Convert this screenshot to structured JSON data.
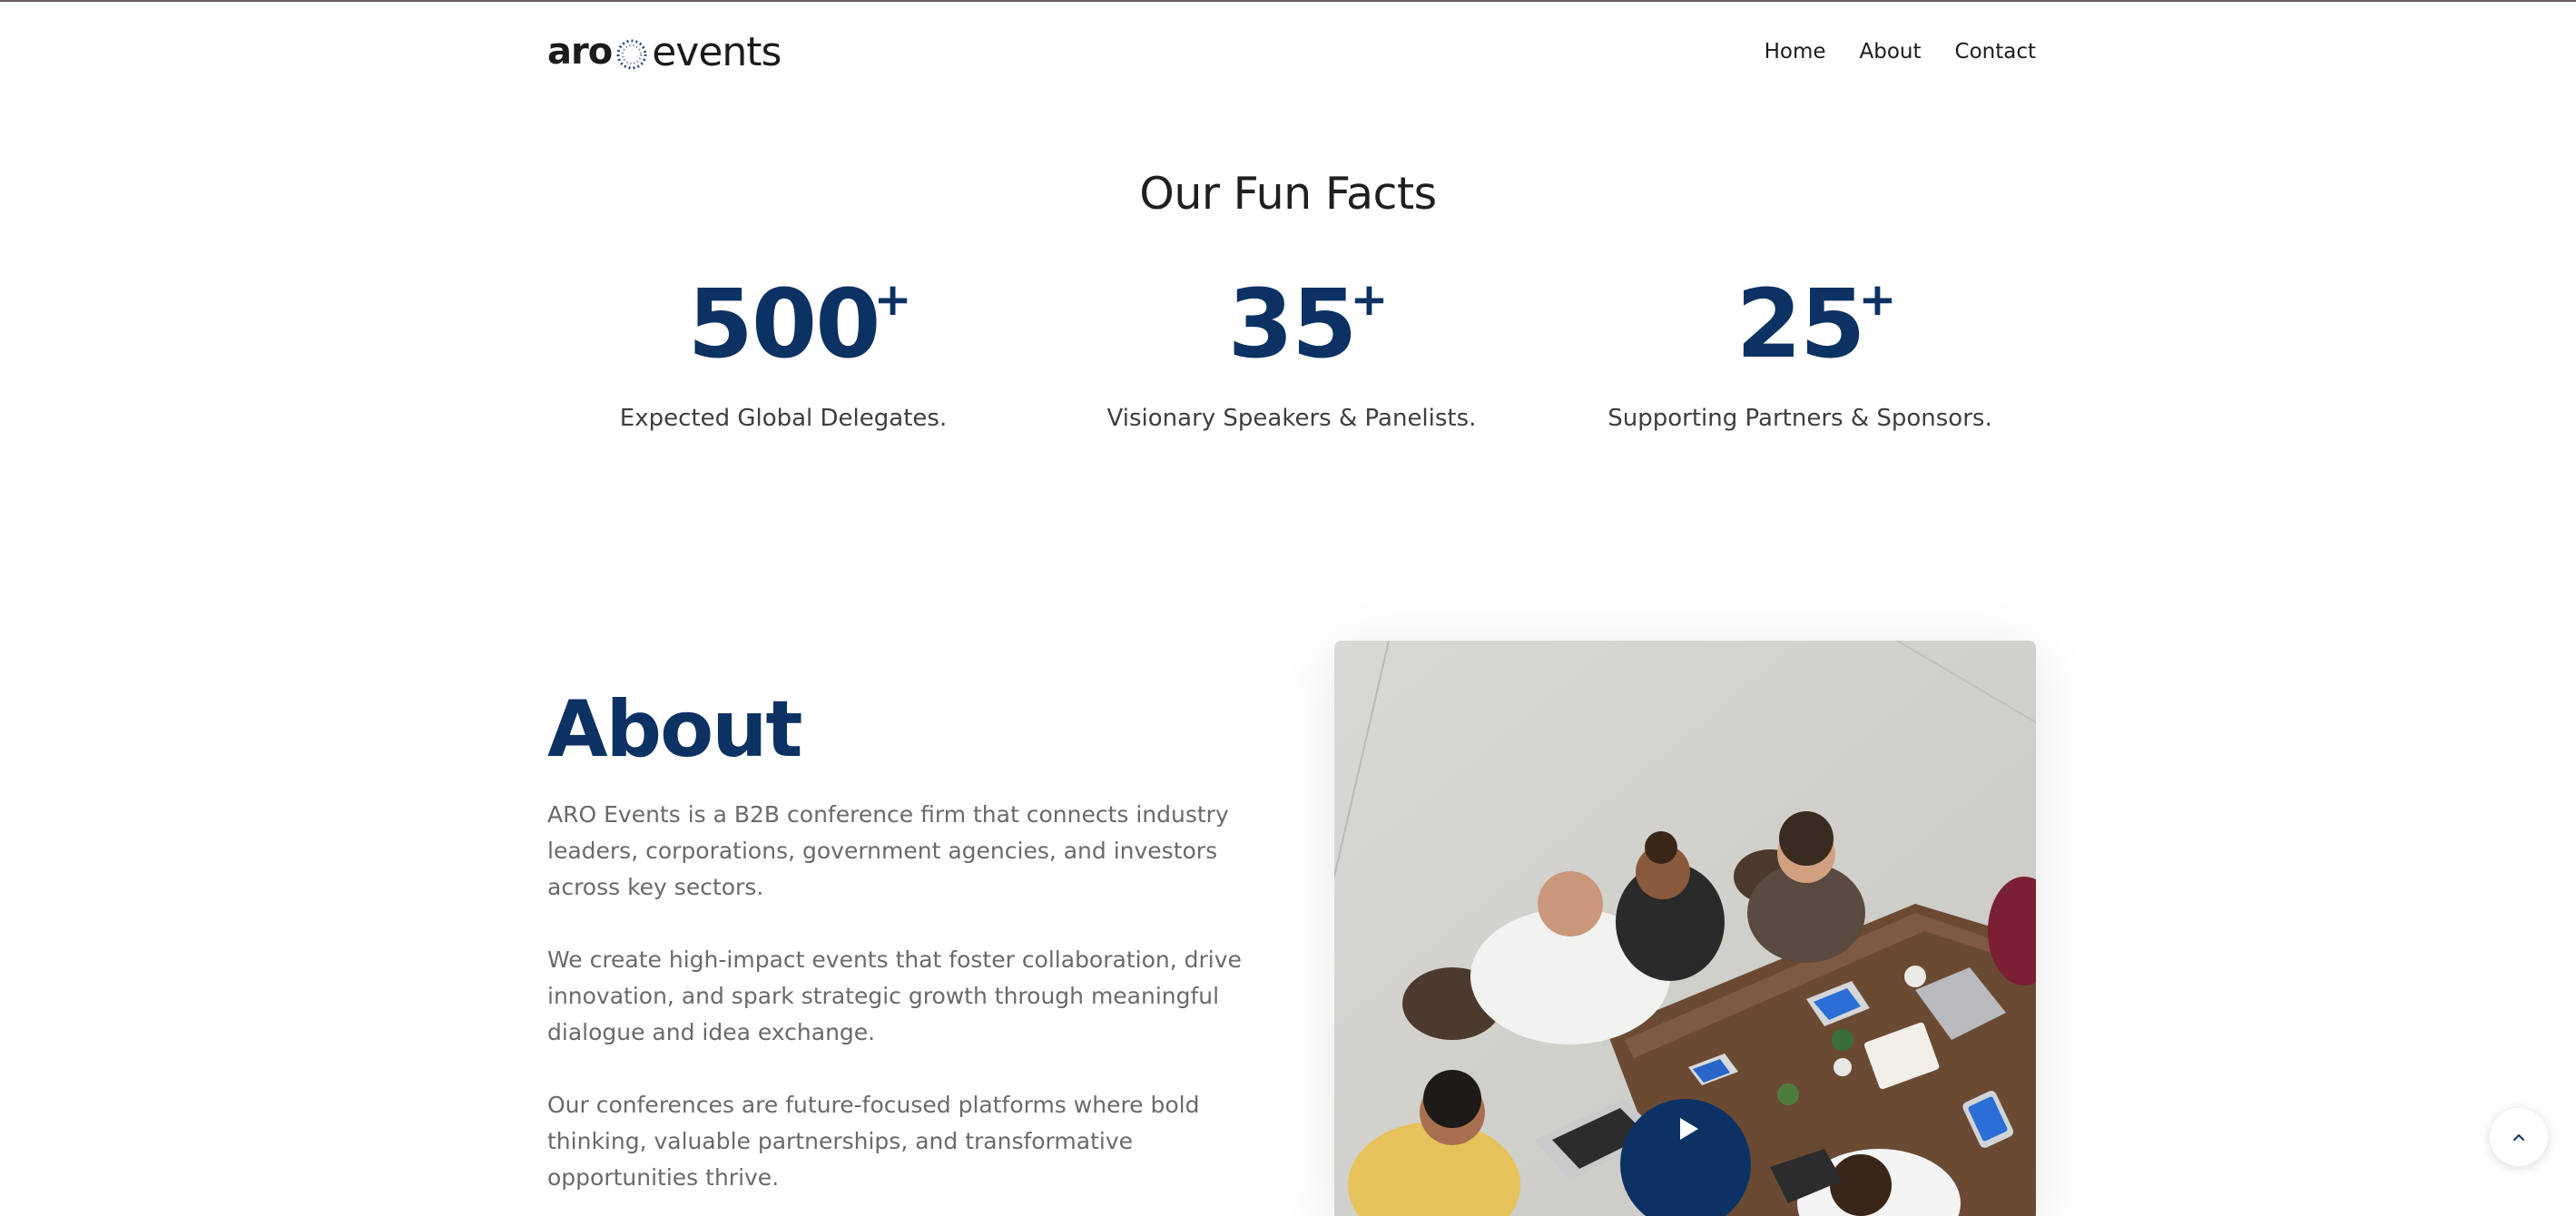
{
  "brand": {
    "logo_left": "aro",
    "logo_right": "events"
  },
  "nav": {
    "items": [
      {
        "label": "Home"
      },
      {
        "label": "About"
      },
      {
        "label": "Contact"
      }
    ]
  },
  "facts": {
    "title": "Our Fun Facts",
    "items": [
      {
        "number": "500",
        "suffix": "+",
        "label": "Expected Global Delegates."
      },
      {
        "number": "35",
        "suffix": "+",
        "label": "Visionary Speakers & Panelists."
      },
      {
        "number": "25",
        "suffix": "+",
        "label": "Supporting Partners & Sponsors."
      }
    ]
  },
  "about": {
    "title": "About",
    "paragraphs": [
      "ARO Events is a B2B conference firm that connects industry leaders, corporations, government agencies, and investors across key sectors.",
      "We create high-impact events that foster collaboration, drive innovation, and spark strategic growth through meaningful dialogue and idea exchange.",
      "Our conferences are future-focused platforms where bold thinking, valuable partnerships, and transformative opportunities thrive."
    ]
  },
  "icons": {
    "play": "play-icon",
    "scroll_top": "chevron-up-icon",
    "logo_mark": "dotted-ring-icon"
  },
  "colors": {
    "accent": "#0c3264",
    "text": "#1b1b1b",
    "muted": "#6a6a6a"
  }
}
